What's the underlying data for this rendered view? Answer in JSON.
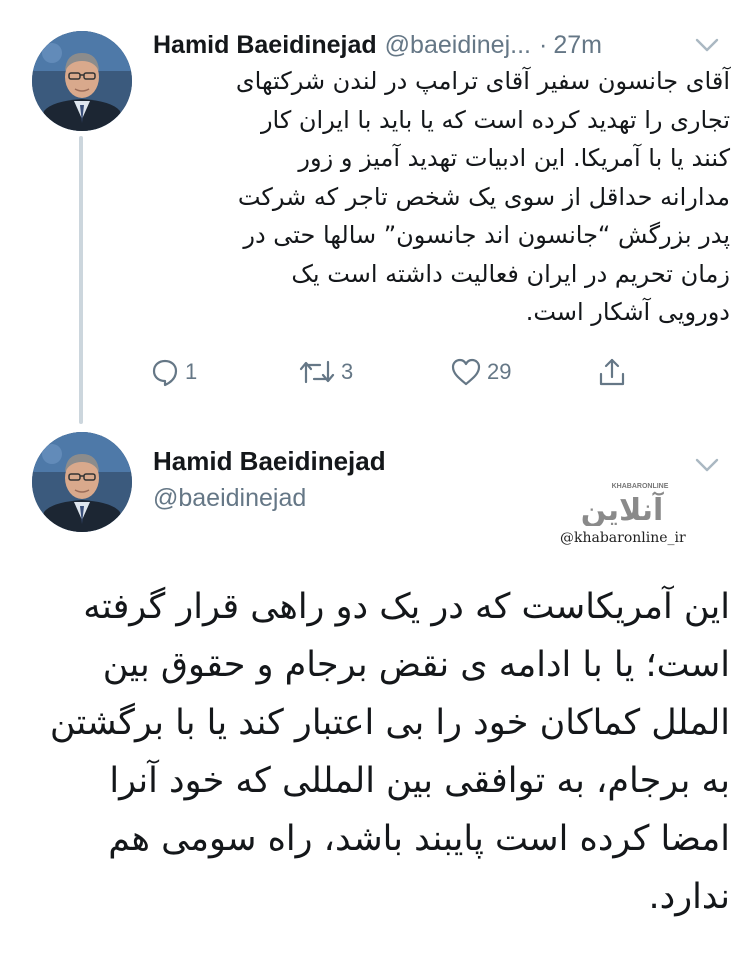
{
  "tweet1": {
    "author_name": "Hamid Baeidinejad",
    "handle": "@baeidinej...",
    "separator": "·",
    "time": "27m",
    "body_lines": [
      "آقای جانسون سفیر آقای ترامپ در لندن شرکتهای",
      "تجاری را تهدید کرده است که یا باید با ایران کار",
      "کنند یا با آمریکا. این ادبیات تهدید آمیز و زور",
      "مدارانه حداقل از سوی یک شخص تاجر که شرکت",
      "پدر بزرگش “جانسون اند جانسون” سالها حتی در",
      "زمان تحریم در ایران فعالیت داشته است یک",
      "دورویی آشکار است."
    ],
    "actions": {
      "reply_count": "1",
      "retweet_count": "3",
      "like_count": "29"
    },
    "icons": {
      "reply": "reply-icon",
      "retweet": "retweet-icon",
      "like": "heart-icon",
      "share": "share-icon",
      "menu": "chevron-down-icon"
    }
  },
  "tweet2": {
    "author_name": "Hamid Baeidinejad",
    "handle": "@baeidinejad",
    "body_lines": [
      "این آمریکاست که در یک دو راهی قرار گرفته",
      "است؛ یا با ادامه ی نقض برجام و حقوق بین",
      "الملل کماکان خود را بی اعتبار کند یا با برگشتن",
      "به برجام، به توافقی بین المللی که خود آنرا",
      "امضا کرده است پایبند باشد، راه سومی هم",
      "ندارد."
    ]
  },
  "watermark": {
    "logo_text": "آنلاین",
    "logo_small_text": "KHABARONLINE",
    "handle": "@khabaronline_ir"
  },
  "colors": {
    "text": "#14171a",
    "muted": "#657786",
    "thread_line": "#ccd6dd",
    "avatar_background": "#3b5a7d"
  }
}
